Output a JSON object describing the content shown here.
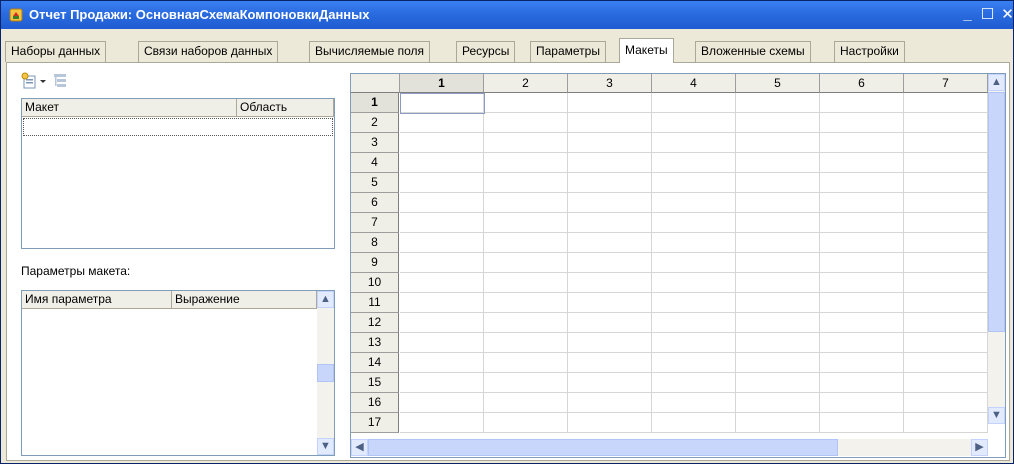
{
  "window": {
    "title": "Отчет Продажи: ОсновнаяСхемаКомпоновкиДанных",
    "controls": {
      "minimize": "_",
      "maximize": "☐",
      "close": "✕"
    }
  },
  "tabs": [
    {
      "label": "Наборы данных",
      "active": false
    },
    {
      "label": "Связи наборов данных",
      "active": false
    },
    {
      "label": "Вычисляемые поля",
      "active": false
    },
    {
      "label": "Ресурсы",
      "active": false
    },
    {
      "label": "Параметры",
      "active": false
    },
    {
      "label": "Макеты",
      "active": true
    },
    {
      "label": "Вложенные схемы",
      "active": false
    },
    {
      "label": "Настройки",
      "active": false
    }
  ],
  "layouts_panel": {
    "toolbar": {
      "add_icon": "add-layout-icon",
      "dropdown_icon": "chevron-down-icon",
      "second_icon": "layout-tree-icon"
    },
    "columns": [
      "Макет",
      "Область"
    ],
    "rows": []
  },
  "params_panel": {
    "label": "Параметры макета:",
    "columns": [
      "Имя параметра",
      "Выражение"
    ],
    "rows": []
  },
  "spreadsheet": {
    "columns": [
      "1",
      "2",
      "3",
      "4",
      "5",
      "6",
      "7"
    ],
    "rows": [
      "1",
      "2",
      "3",
      "4",
      "5",
      "6",
      "7",
      "8",
      "9",
      "10",
      "11",
      "12",
      "13",
      "14",
      "15",
      "16",
      "17"
    ],
    "selected_cell": {
      "row": "1",
      "col": "1"
    }
  },
  "colors": {
    "titlebar": "#2A6BE0",
    "window_bg": "#ECE9D8",
    "header_bg": "#F0EFE7"
  }
}
